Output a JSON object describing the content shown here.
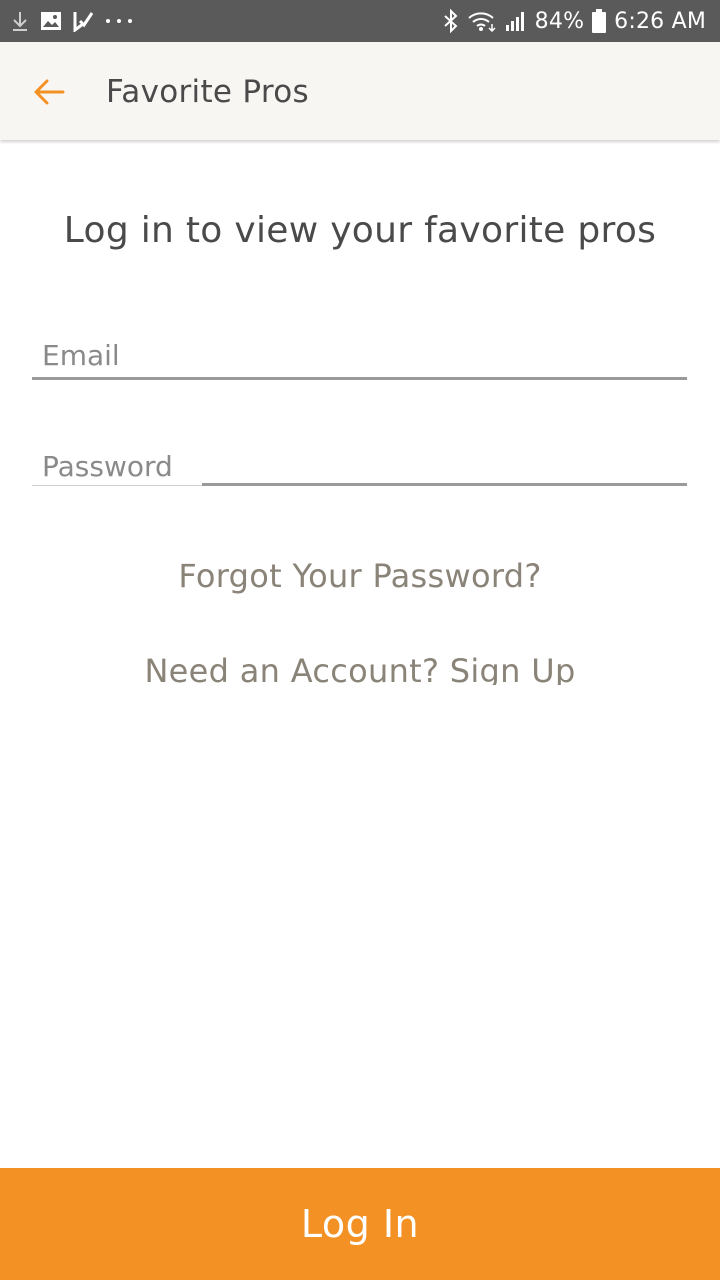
{
  "status_bar": {
    "battery_percent": "84%",
    "time": "6:26 AM",
    "left_icons": [
      "download-icon",
      "image-icon",
      "check-icon",
      "more-dots-icon"
    ],
    "right_icons": [
      "bluetooth-icon",
      "wifi-icon",
      "signal-icon",
      "battery-icon"
    ]
  },
  "app_bar": {
    "title": "Favorite Pros",
    "back_icon": "arrow-left-icon",
    "accent_color": "#f39124"
  },
  "main": {
    "heading": "Log in to view your favorite pros",
    "email_placeholder": "Email",
    "password_placeholder": "Password",
    "forgot_password_label": "Forgot Your Password?",
    "signup_label": "Need an Account? Sign Up"
  },
  "footer": {
    "login_label": "Log In",
    "button_color": "#f39124"
  }
}
